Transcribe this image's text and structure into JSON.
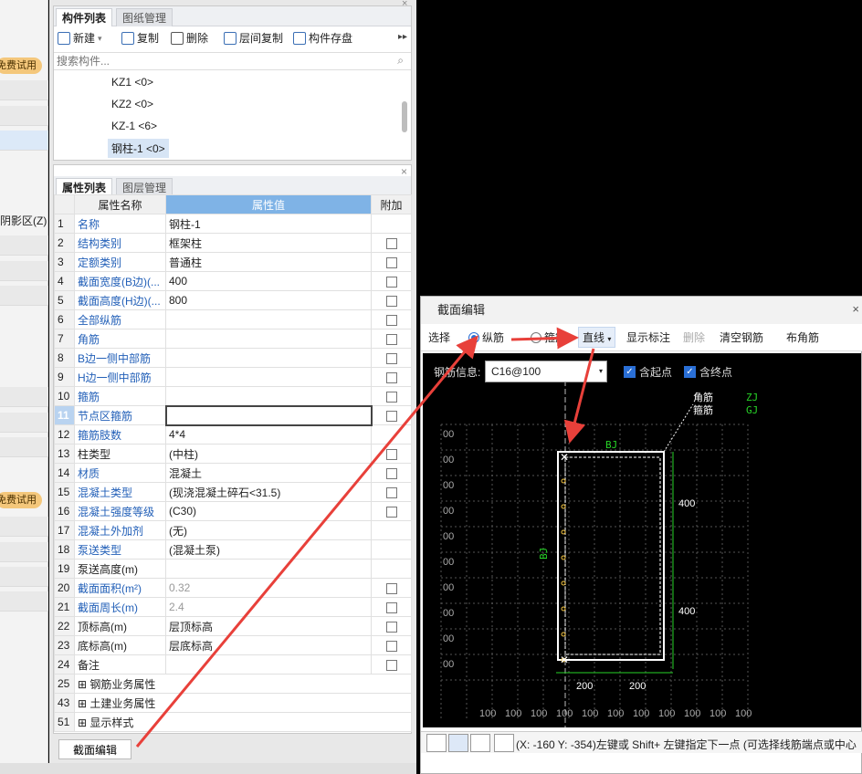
{
  "left_strip": {
    "badge1": "免费试用",
    "region_label": "阴影区(Z)",
    "badge2": "免费试用"
  },
  "component_panel": {
    "tabs": [
      "构件列表",
      "图纸管理"
    ],
    "toolbar": {
      "new": "新建",
      "copy": "复制",
      "delete": "删除",
      "layer_copy": "层间复制",
      "save": "构件存盘"
    },
    "search_placeholder": "搜索构件...",
    "items": [
      "KZ1 <0>",
      "KZ2 <0>",
      "KZ-1 <6>",
      "钢柱-1 <0>"
    ]
  },
  "property_panel": {
    "tabs": [
      "属性列表",
      "图层管理"
    ],
    "headers": {
      "name": "属性名称",
      "value": "属性值",
      "extra": "附加"
    },
    "rows": [
      {
        "n": "1",
        "name": "名称",
        "value": "钢柱-1",
        "blue": true,
        "cb": false
      },
      {
        "n": "2",
        "name": "结构类别",
        "value": "框架柱",
        "blue": true,
        "cb": true
      },
      {
        "n": "3",
        "name": "定额类别",
        "value": "普通柱",
        "blue": true,
        "cb": true
      },
      {
        "n": "4",
        "name": "截面宽度(B边)(...",
        "value": "400",
        "blue": true,
        "cb": true
      },
      {
        "n": "5",
        "name": "截面高度(H边)(...",
        "value": "800",
        "blue": true,
        "cb": true
      },
      {
        "n": "6",
        "name": "全部纵筋",
        "value": "",
        "blue": true,
        "cb": true
      },
      {
        "n": "7",
        "name": "角筋",
        "value": "",
        "blue": true,
        "cb": true
      },
      {
        "n": "8",
        "name": "B边一侧中部筋",
        "value": "",
        "blue": true,
        "cb": true
      },
      {
        "n": "9",
        "name": "H边一侧中部筋",
        "value": "",
        "blue": true,
        "cb": true
      },
      {
        "n": "10",
        "name": "箍筋",
        "value": "",
        "blue": true,
        "cb": true
      },
      {
        "n": "11",
        "name": "节点区箍筋",
        "value": "",
        "blue": true,
        "cb": true,
        "sel": true
      },
      {
        "n": "12",
        "name": "箍筋肢数",
        "value": "4*4",
        "blue": true,
        "cb": false
      },
      {
        "n": "13",
        "name": "柱类型",
        "value": "(中柱)",
        "blue": false,
        "cb": true
      },
      {
        "n": "14",
        "name": "材质",
        "value": "混凝土",
        "blue": true,
        "cb": true
      },
      {
        "n": "15",
        "name": "混凝土类型",
        "value": "(现浇混凝土碎石<31.5)",
        "blue": true,
        "cb": true
      },
      {
        "n": "16",
        "name": "混凝土强度等级",
        "value": "(C30)",
        "blue": true,
        "cb": true
      },
      {
        "n": "17",
        "name": "混凝土外加剂",
        "value": "(无)",
        "blue": true,
        "cb": false
      },
      {
        "n": "18",
        "name": "泵送类型",
        "value": "(混凝土泵)",
        "blue": true,
        "cb": false
      },
      {
        "n": "19",
        "name": "泵送高度(m)",
        "value": "",
        "blue": false,
        "cb": false
      },
      {
        "n": "20",
        "name": "截面面积(m²)",
        "value": "0.32",
        "blue": true,
        "cb": true,
        "gray": true
      },
      {
        "n": "21",
        "name": "截面周长(m)",
        "value": "2.4",
        "blue": true,
        "cb": true,
        "gray": true
      },
      {
        "n": "22",
        "name": "顶标高(m)",
        "value": "层顶标高",
        "blue": false,
        "cb": true
      },
      {
        "n": "23",
        "name": "底标高(m)",
        "value": "层底标高",
        "blue": false,
        "cb": true
      },
      {
        "n": "24",
        "name": "备注",
        "value": "",
        "blue": false,
        "cb": true
      },
      {
        "n": "25",
        "name": "钢筋业务属性",
        "value": "",
        "blue": false,
        "cb": false,
        "group": true
      },
      {
        "n": "43",
        "name": "土建业务属性",
        "value": "",
        "blue": false,
        "cb": false,
        "group": true
      },
      {
        "n": "51",
        "name": "显示样式",
        "value": "",
        "blue": false,
        "cb": false,
        "group": true
      }
    ],
    "section_edit_button": "截面编辑"
  },
  "dialog": {
    "title": "截面编辑",
    "toolbar": {
      "select": "选择",
      "longitudinal": "纵筋",
      "stirrup": "箍筋",
      "line": "直线",
      "show_dim": "显示标注",
      "delete": "删除",
      "clear": "清空钢筋",
      "corner": "布角筋"
    },
    "rebar_info_label": "钢筋信息:",
    "rebar_info_value": "C16@100",
    "start_point": "含起点",
    "end_point": "含终点",
    "canvas": {
      "legend_corner": "角筋",
      "legend_stirrup": "箍筋",
      "legend_zj": "ZJ",
      "legend_gj": "GJ",
      "top_label": "BJ",
      "side_label": "BJ",
      "dim_400a": "400",
      "dim_400b": "400",
      "dim_200a": "200",
      "dim_200b": "200",
      "grid_label": "00",
      "bottom_grid": "100"
    },
    "status_text": "(X: -160 Y: -354)左键或 Shift+ 左键指定下一点 (可选择线筋端点或中心"
  },
  "colors": {
    "accent": "#7fb3e6",
    "arrow": "#e8403a",
    "canvas_green": "#27d327",
    "badge": "#f4c77b"
  }
}
